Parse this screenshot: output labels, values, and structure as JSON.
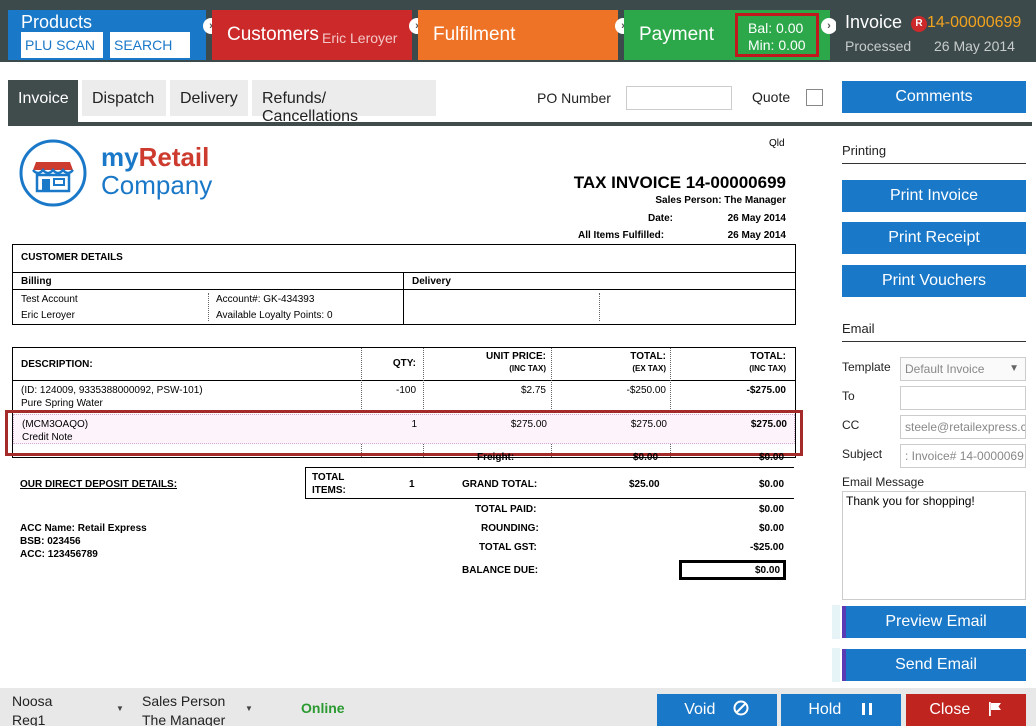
{
  "workflow": {
    "products": {
      "title": "Products",
      "plu_scan": "PLU SCAN",
      "search": "SEARCH"
    },
    "customers": {
      "title": "Customers",
      "name": "Eric Leroyer"
    },
    "fulfilment": {
      "title": "Fulfilment"
    },
    "payment": {
      "title": "Payment",
      "bal": "Bal:  0.00",
      "min": "Min:  0.00"
    },
    "invoice": {
      "title": "Invoice",
      "badge": "R",
      "number": "14-00000699",
      "status": "Processed",
      "date": "26 May 2014"
    }
  },
  "tabs": [
    {
      "label": "Invoice",
      "active": true
    },
    {
      "label": "Dispatch"
    },
    {
      "label": "Delivery"
    },
    {
      "label": "Refunds/ Cancellations"
    }
  ],
  "po_label": "PO Number",
  "po_value": "",
  "quote_label": "Quote",
  "comments_label": "Comments",
  "document": {
    "logo_line1_a": "my",
    "logo_line1_b": "Retail",
    "logo_line2": "Company",
    "state": "Qld",
    "title": "TAX INVOICE 14-00000699",
    "sales_person": "Sales Person: The Manager",
    "date_label": "Date:",
    "date_value": "26 May 2014",
    "fulfilled_label": "All Items Fulfilled:",
    "fulfilled_value": "26 May 2014",
    "customer_details": "CUSTOMER DETAILS",
    "billing": "Billing",
    "delivery": "Delivery",
    "billing_name": "Test Account",
    "billing_contact": "Eric Leroyer",
    "account_no": "Account#: GK-434393",
    "loyalty": "Available Loyalty Points: 0",
    "headers": {
      "description": "DESCRIPTION:",
      "qty": "QTY:",
      "unit_price": "UNIT PRICE:",
      "unit_price_sub": "(INC TAX)",
      "total_ex": "TOTAL:",
      "total_ex_sub": "(EX TAX)",
      "total_inc": "TOTAL:",
      "total_inc_sub": "(INC TAX)"
    },
    "rows": [
      {
        "line1": "(ID: 124009, 9335388000092, PSW-101)",
        "line2": "Pure Spring Water",
        "qty": "-100",
        "unit": "$2.75",
        "ex": "-$250.00",
        "inc": "-$275.00"
      },
      {
        "line1": "(MCM3OAQO)",
        "line2": "Credit Note",
        "qty": "1",
        "unit": "$275.00",
        "ex": "$275.00",
        "inc": "$275.00"
      }
    ],
    "freight_label": "Freight:",
    "freight_ex": "$0.00",
    "freight_inc": "$0.00",
    "deposit_title": "OUR DIRECT DEPOSIT DETAILS:",
    "acc_name": "ACC Name: Retail Express",
    "bsb": "BSB: 023456",
    "acc": "ACC: 123456789",
    "total_items_label1": "TOTAL",
    "total_items_label2": "ITEMS:",
    "total_items": "1",
    "grand_total_label": "GRAND TOTAL:",
    "grand_total_ex": "$25.00",
    "grand_total_inc": "$0.00",
    "total_paid_label": "TOTAL PAID:",
    "total_paid": "$0.00",
    "rounding_label": "ROUNDING:",
    "rounding": "$0.00",
    "total_gst_label": "TOTAL GST:",
    "total_gst": "-$25.00",
    "balance_due_label": "BALANCE DUE:",
    "balance_due": "$0.00"
  },
  "side": {
    "printing": "Printing",
    "print_invoice": "Print Invoice",
    "print_receipt": "Print Receipt",
    "print_vouchers": "Print Vouchers",
    "email": "Email",
    "template_label": "Template",
    "template_value": "Default Invoice",
    "to_label": "To",
    "to_value": "",
    "cc_label": "CC",
    "cc_value": "steele@retailexpress.c",
    "subject_label": "Subject",
    "subject_value": ": Invoice# 14-0000069",
    "message_label": "Email Message",
    "message_value": "Thank you for shopping!",
    "preview_email": "Preview Email",
    "send_email": "Send Email"
  },
  "footer": {
    "store": "Noosa",
    "register": "Reg1",
    "sales_person_label": "Sales Person",
    "sales_person": "The Manager",
    "status": "Online",
    "void": "Void",
    "hold": "Hold",
    "close": "Close"
  }
}
